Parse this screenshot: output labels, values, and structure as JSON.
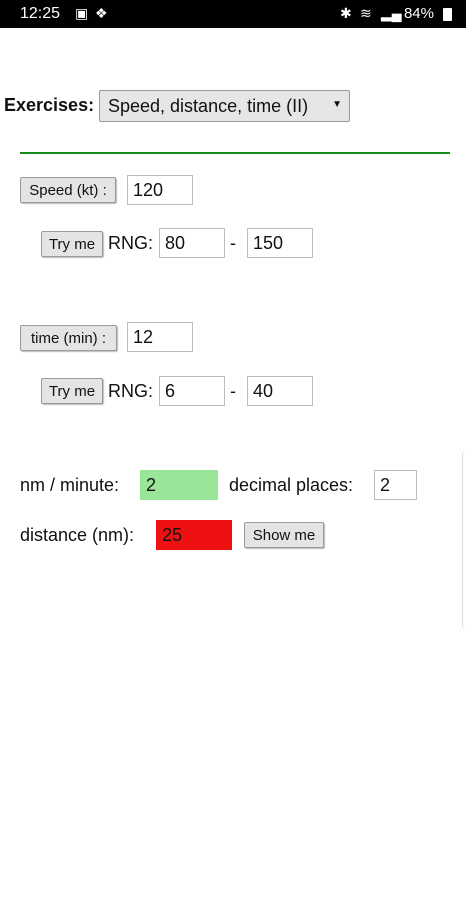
{
  "status_bar": {
    "time": "12:25",
    "battery": "84%",
    "icons": [
      "image-icon",
      "dropbox-icon",
      "bluetooth-icon",
      "wifi-icon",
      "signal-icon",
      "battery-icon"
    ]
  },
  "exercises": {
    "label": "Exercises:",
    "selected": "Speed, distance, time (II)"
  },
  "accent_color": "#1a8a1a",
  "speed": {
    "button": "Speed (kt) :",
    "value": "120",
    "try_button": "Try me",
    "rng_label": "RNG:",
    "min": "80",
    "dash": "-",
    "max": "150"
  },
  "time": {
    "button": "time (min) :",
    "value": "12",
    "try_button": "Try me",
    "rng_label": "RNG:",
    "min": "6",
    "dash": "-",
    "max": "40"
  },
  "results": {
    "nm_per_minute_label": "nm / minute:",
    "nm_per_minute_value": "2",
    "nm_per_minute_color": "#99e699",
    "decimal_label": "decimal places:",
    "decimal_value": "2",
    "distance_label": "distance (nm):",
    "distance_value": "25",
    "distance_color": "#ee1111",
    "show_button": "Show me"
  }
}
